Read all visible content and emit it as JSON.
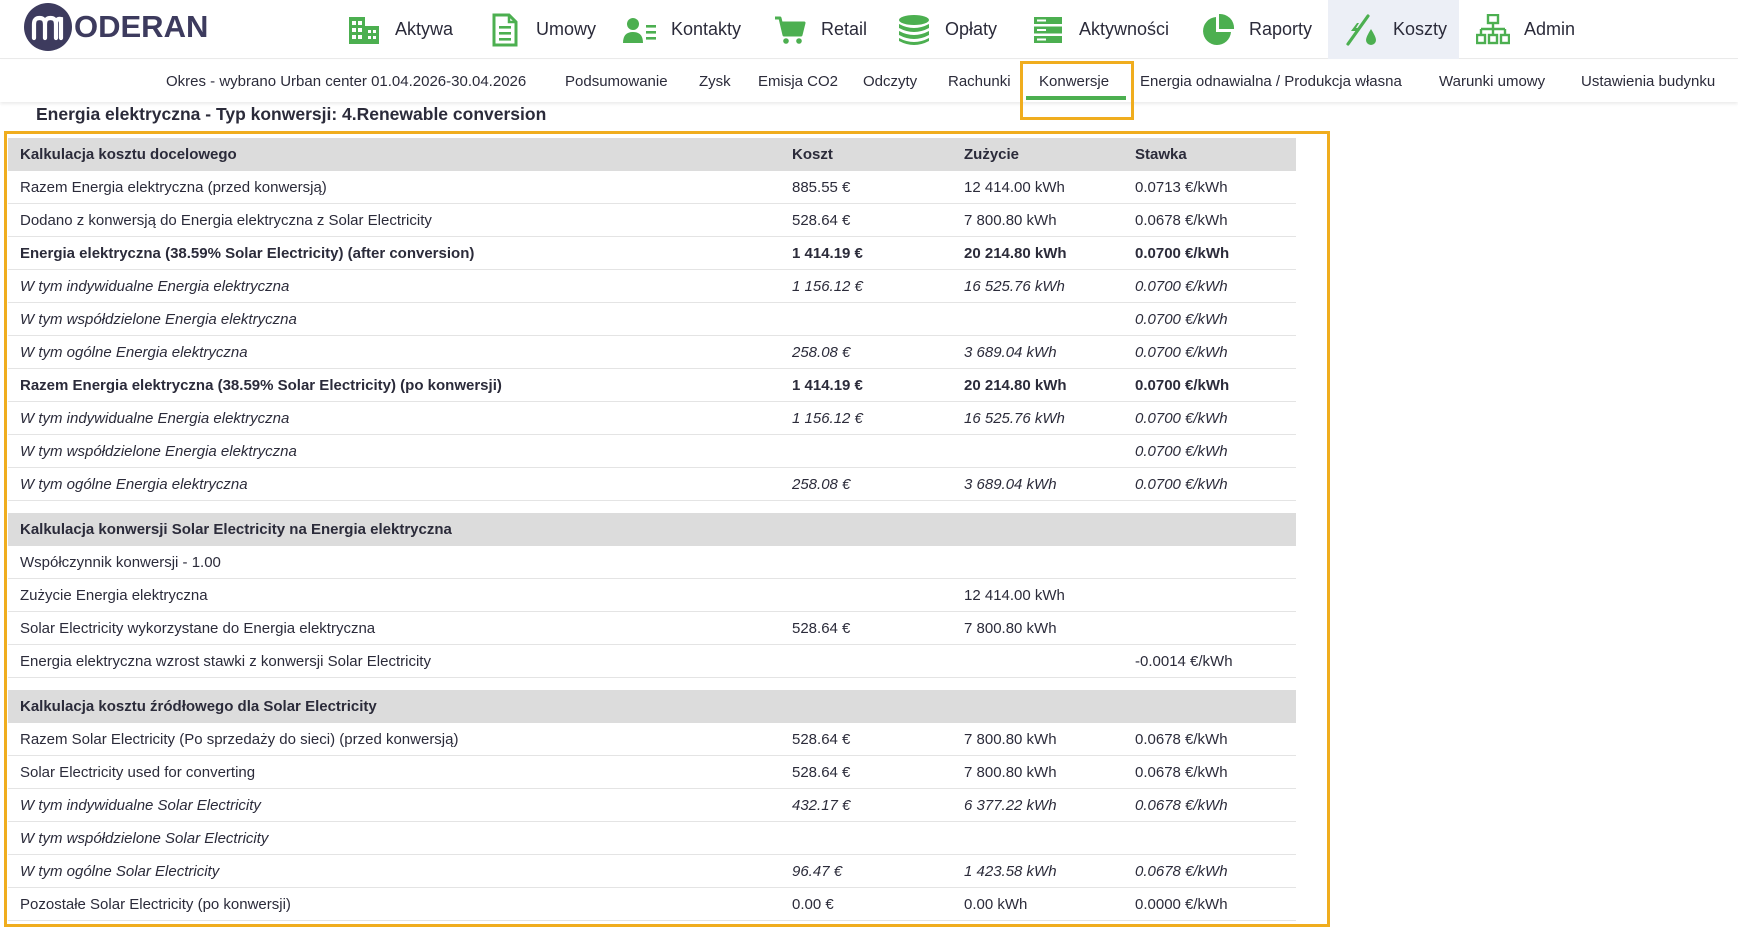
{
  "app": {
    "logo_text": "ODERAN",
    "logo_letter": "m"
  },
  "nav": [
    {
      "label": "Aktywa",
      "icon": "buildings-icon",
      "active": false
    },
    {
      "label": "Umowy",
      "icon": "document-icon",
      "active": false
    },
    {
      "label": "Kontakty",
      "icon": "contacts-icon",
      "active": false
    },
    {
      "label": "Retail",
      "icon": "cart-icon",
      "active": false
    },
    {
      "label": "Opłaty",
      "icon": "coins-icon",
      "active": false
    },
    {
      "label": "Aktywności",
      "icon": "server-icon",
      "active": false
    },
    {
      "label": "Raporty",
      "icon": "pie-chart-icon",
      "active": false
    },
    {
      "label": "Koszty",
      "icon": "costs-icon",
      "active": true
    },
    {
      "label": "Admin",
      "icon": "hierarchy-icon",
      "active": false
    }
  ],
  "subnav": {
    "period": "Okres - wybrano Urban center 01.04.2026-30.04.2026",
    "items": [
      "Podsumowanie",
      "Zysk",
      "Emisja CO2",
      "Odczyty",
      "Rachunki",
      "Konwersje",
      "Energia odnawialna / Produkcja własna",
      "Warunki umowy",
      "Ustawienia budynku"
    ],
    "active": "Konwersje"
  },
  "page_title": "Energia elektryczna - Typ konwersji: 4.Renewable conversion",
  "colors": {
    "accent_green": "#4caf50",
    "highlight_orange": "#f0ad1e",
    "brand_dark": "#3d3b5e",
    "section_header_bg": "#dcdcdc"
  },
  "sections": [
    {
      "header": [
        "Kalkulacja kosztu docelowego",
        "Koszt",
        "Zużycie",
        "Stawka"
      ],
      "rows": [
        {
          "style": "normal",
          "cells": [
            "Razem Energia elektryczna (przed konwersją)",
            "885.55 €",
            "12 414.00 kWh",
            "0.0713 €/kWh"
          ]
        },
        {
          "style": "normal",
          "cells": [
            "Dodano z konwersją do Energia elektryczna z Solar Electricity",
            "528.64 €",
            "7 800.80 kWh",
            "0.0678 €/kWh"
          ]
        },
        {
          "style": "bold",
          "cells": [
            "Energia elektryczna (38.59% Solar Electricity) (after conversion)",
            "1 414.19 €",
            "20 214.80 kWh",
            "0.0700 €/kWh"
          ]
        },
        {
          "style": "ital",
          "cells": [
            "W tym indywidualne Energia elektryczna",
            "1 156.12 €",
            "16 525.76 kWh",
            "0.0700 €/kWh"
          ]
        },
        {
          "style": "ital",
          "cells": [
            "W tym współdzielone Energia elektryczna",
            "",
            "",
            "0.0700 €/kWh"
          ]
        },
        {
          "style": "ital",
          "cells": [
            "W tym ogólne Energia elektryczna",
            "258.08 €",
            "3 689.04 kWh",
            "0.0700 €/kWh"
          ]
        },
        {
          "style": "bold",
          "cells": [
            "Razem Energia elektryczna (38.59% Solar Electricity) (po konwersji)",
            "1 414.19 €",
            "20 214.80 kWh",
            "0.0700 €/kWh"
          ]
        },
        {
          "style": "ital",
          "cells": [
            "W tym indywidualne Energia elektryczna",
            "1 156.12 €",
            "16 525.76 kWh",
            "0.0700 €/kWh"
          ]
        },
        {
          "style": "ital",
          "cells": [
            "W tym współdzielone Energia elektryczna",
            "",
            "",
            "0.0700 €/kWh"
          ]
        },
        {
          "style": "ital",
          "cells": [
            "W tym ogólne Energia elektryczna",
            "258.08 €",
            "3 689.04 kWh",
            "0.0700 €/kWh"
          ]
        }
      ]
    },
    {
      "header": [
        "Kalkulacja konwersji Solar Electricity na Energia elektryczna",
        "",
        "",
        ""
      ],
      "rows": [
        {
          "style": "normal",
          "cells": [
            "Współczynnik konwersji - 1.00",
            "",
            "",
            ""
          ]
        },
        {
          "style": "normal",
          "cells": [
            "Zużycie Energia elektryczna",
            "",
            "12 414.00 kWh",
            ""
          ]
        },
        {
          "style": "normal",
          "cells": [
            "Solar Electricity wykorzystane do Energia elektryczna",
            "528.64 €",
            "7 800.80 kWh",
            ""
          ]
        },
        {
          "style": "normal",
          "cells": [
            "Energia elektryczna wzrost stawki z konwersji Solar Electricity",
            "",
            "",
            "-0.0014 €/kWh"
          ]
        }
      ]
    },
    {
      "header": [
        "Kalkulacja kosztu źródłowego dla Solar Electricity",
        "",
        "",
        ""
      ],
      "rows": [
        {
          "style": "normal",
          "cells": [
            "Razem Solar Electricity (Po sprzedaży do sieci) (przed konwersją)",
            "528.64 €",
            "7 800.80 kWh",
            "0.0678 €/kWh"
          ]
        },
        {
          "style": "normal",
          "cells": [
            "Solar Electricity used for converting",
            "528.64 €",
            "7 800.80 kWh",
            "0.0678 €/kWh"
          ]
        },
        {
          "style": "ital",
          "cells": [
            "W tym indywidualne Solar Electricity",
            "432.17 €",
            "6 377.22 kWh",
            "0.0678 €/kWh"
          ]
        },
        {
          "style": "ital",
          "cells": [
            "W tym współdzielone Solar Electricity",
            "",
            "",
            ""
          ]
        },
        {
          "style": "ital",
          "cells": [
            "W tym ogólne Solar Electricity",
            "96.47 €",
            "1 423.58 kWh",
            "0.0678 €/kWh"
          ]
        },
        {
          "style": "normal",
          "cells": [
            "Pozostałe Solar Electricity (po konwersji)",
            "0.00 €",
            "0.00 kWh",
            "0.0000 €/kWh"
          ]
        }
      ]
    }
  ]
}
